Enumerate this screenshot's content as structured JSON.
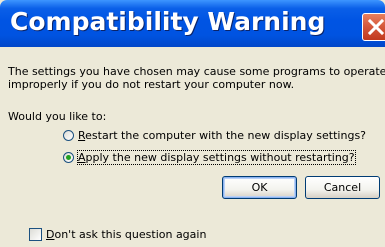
{
  "dialog": {
    "title": "Compatibility Warning",
    "message_line1": "The settings you have chosen may cause some programs to operate",
    "message_line2": "improperly if you do not restart your computer now.",
    "question": "Would you like to:",
    "options": [
      {
        "accel": "R",
        "rest": "estart the computer with the new display settings?",
        "selected": false
      },
      {
        "accel": "A",
        "rest": "pply the new display settings without restarting?",
        "selected": true
      }
    ],
    "ok_label": "OK",
    "cancel_label": "Cancel",
    "checkbox": {
      "accel": "D",
      "rest": "on't ask this question again",
      "checked": false
    }
  },
  "colors": {
    "titlebar": "#0054e3",
    "close_button": "#d4563a",
    "dialog_bg": "#ece9d8",
    "radio_dot": "#21a121"
  },
  "icons": {
    "close": "close-icon"
  }
}
